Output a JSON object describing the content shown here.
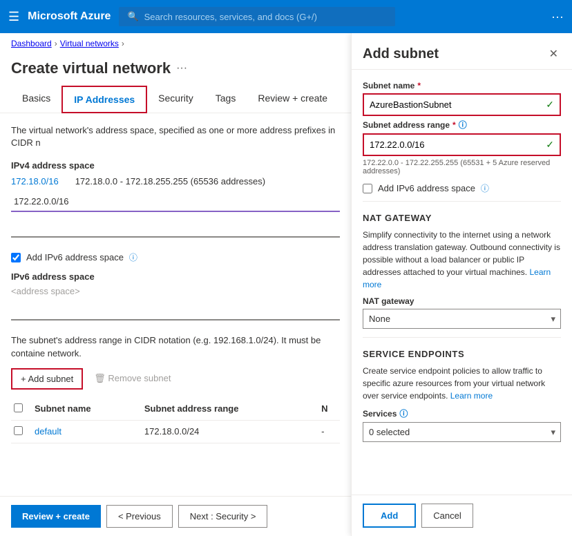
{
  "topnav": {
    "hamburger": "☰",
    "brand": "Microsoft Azure",
    "search_placeholder": "Search resources, services, and docs (G+/)",
    "dots": "···"
  },
  "breadcrumb": {
    "items": [
      "Dashboard",
      "Virtual networks"
    ],
    "separators": [
      ">",
      ">"
    ]
  },
  "page": {
    "title": "Create virtual network",
    "dots_menu": "···"
  },
  "tabs": [
    {
      "label": "Basics",
      "state": "normal"
    },
    {
      "label": "IP Addresses",
      "state": "active-red"
    },
    {
      "label": "Security",
      "state": "normal"
    },
    {
      "label": "Tags",
      "state": "normal"
    },
    {
      "label": "Review + create",
      "state": "normal"
    }
  ],
  "content": {
    "desc": "The virtual network's address space, specified as one or more address prefixes in CIDR n",
    "ipv4_section_title": "IPv4 address space",
    "ipv4_address": "172.18.0/16",
    "ipv4_range": "172.18.0.0 - 172.18.255.255 (65536 addresses)",
    "ipv4_input_value": "172.22.0.0/16",
    "ipv4_input2_value": "",
    "checkbox_ipv6_label": "Add IPv6 address space",
    "checkbox_ipv6_checked": true,
    "ipv6_section_title": "IPv6 address space",
    "ipv6_placeholder": "<address space>",
    "subnet_desc": "The subnet's address range in CIDR notation (e.g. 192.168.1.0/24). It must be containe network.",
    "subnet_link": "network.",
    "add_subnet_label": "+ Add subnet",
    "remove_subnet_label": "🗑 Remove subnet",
    "table": {
      "columns": [
        "Subnet name",
        "Subnet address range",
        "N"
      ],
      "rows": [
        {
          "name": "default",
          "range": "172.18.0.0/24",
          "extra": "-"
        }
      ]
    }
  },
  "footer": {
    "review_create_label": "Review + create",
    "previous_label": "< Previous",
    "next_label": "Next : Security >"
  },
  "right_panel": {
    "title": "Add subnet",
    "close_label": "✕",
    "subnet_name_label": "Subnet name",
    "subnet_name_required": "*",
    "subnet_name_value": "AzureBastionSubnet",
    "subnet_address_label": "Subnet address range",
    "subnet_address_required": "*",
    "subnet_address_value": "172.22.0.0/16",
    "subnet_address_range_hint": "172.22.0.0 - 172.22.255.255 (65531 + 5 Azure reserved addresses)",
    "add_ipv6_label": "Add IPv6 address space",
    "nat_gateway_section": "NAT GATEWAY",
    "nat_gateway_desc": "Simplify connectivity to the internet using a network address translation gateway. Outbound connectivity is possible without a load balancer or public IP addresses attached to your virtual machines.",
    "nat_gateway_learn_more": "Learn more",
    "nat_gateway_label": "NAT gateway",
    "nat_gateway_option": "None",
    "nat_gateway_options": [
      "None"
    ],
    "service_endpoints_section": "SERVICE ENDPOINTS",
    "service_endpoints_desc": "Create service endpoint policies to allow traffic to specific azure resources from your virtual network over service endpoints.",
    "service_endpoints_learn_more": "Learn more",
    "services_label": "Services",
    "services_value": "0 selected",
    "services_options": [
      "0 selected"
    ],
    "add_label": "Add",
    "cancel_label": "Cancel"
  }
}
